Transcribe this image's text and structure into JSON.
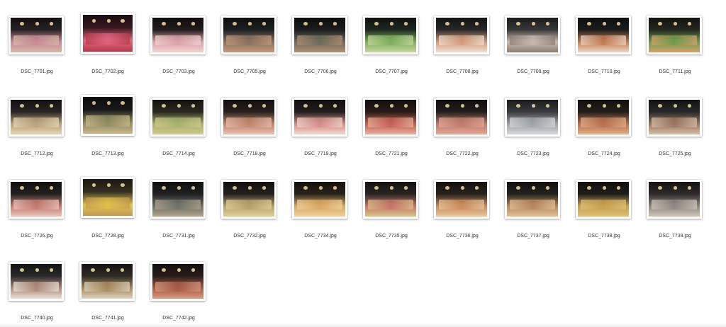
{
  "files": [
    {
      "name": "DSC_7701.jpg",
      "tones": [
        "#2a2326",
        "#c98a94",
        "#d4b9a8"
      ]
    },
    {
      "name": "DSC_7702.jpg",
      "tones": [
        "#3a1a22",
        "#e2657f",
        "#b33a4a"
      ]
    },
    {
      "name": "DSC_7703.jpg",
      "tones": [
        "#241d1d",
        "#dca0a8",
        "#f0d4d0"
      ]
    },
    {
      "name": "DSC_7705.jpg",
      "tones": [
        "#1e2124",
        "#8a6f60",
        "#c59a7a"
      ]
    },
    {
      "name": "DSC_7706.jpg",
      "tones": [
        "#1c1d1e",
        "#6d6a5a",
        "#b38e76"
      ]
    },
    {
      "name": "DSC_7707.jpg",
      "tones": [
        "#1f2a22",
        "#7cae5c",
        "#c9d7a0"
      ]
    },
    {
      "name": "DSC_7708.jpg",
      "tones": [
        "#2b2a2a",
        "#d39a7a",
        "#efe0d4"
      ]
    },
    {
      "name": "DSC_7709.jpg",
      "tones": [
        "#3c3b3b",
        "#c8bcb0",
        "#8a7e72"
      ]
    },
    {
      "name": "DSC_7710.jpg",
      "tones": [
        "#1e1e1e",
        "#c27a52",
        "#ead8c8"
      ]
    },
    {
      "name": "DSC_7711.jpg",
      "tones": [
        "#262a21",
        "#6f9c4e",
        "#d6a06c"
      ]
    },
    {
      "name": "DSC_7712.jpg",
      "tones": [
        "#2a2725",
        "#b8a27a",
        "#e6d6b4"
      ]
    },
    {
      "name": "DSC_7713.jpg",
      "tones": [
        "#1a1a1a",
        "#8f8a60",
        "#c9b98c"
      ]
    },
    {
      "name": "DSC_7714.jpg",
      "tones": [
        "#2b2a22",
        "#a5b36a",
        "#d5c690"
      ]
    },
    {
      "name": "DSC_7718.jpg",
      "tones": [
        "#2a2220",
        "#c0856c",
        "#e9bfb0"
      ]
    },
    {
      "name": "DSC_7719.jpg",
      "tones": [
        "#24201f",
        "#d58c88",
        "#f0d8cc"
      ]
    },
    {
      "name": "DSC_7721.jpg",
      "tones": [
        "#2b1d1b",
        "#c65f55",
        "#e8b29c"
      ]
    },
    {
      "name": "DSC_7722.jpg",
      "tones": [
        "#231f1e",
        "#c07b6c",
        "#e3a898"
      ]
    },
    {
      "name": "DSC_7723.jpg",
      "tones": [
        "#3b3d40",
        "#9ea3a8",
        "#d8d9da"
      ]
    },
    {
      "name": "DSC_7724.jpg",
      "tones": [
        "#27201d",
        "#b86f50",
        "#e2b08a"
      ]
    },
    {
      "name": "DSC_7725.jpg",
      "tones": [
        "#2a2a2b",
        "#9a7560",
        "#d8c0a8"
      ]
    },
    {
      "name": "DSC_7726.jpg",
      "tones": [
        "#262322",
        "#c47870",
        "#e8c8bc"
      ]
    },
    {
      "name": "DSC_7728.jpg",
      "tones": [
        "#3a3324",
        "#e0c24a",
        "#c29a56"
      ]
    },
    {
      "name": "DSC_7731.jpg",
      "tones": [
        "#1f2123",
        "#6d7168",
        "#b3a48c"
      ]
    },
    {
      "name": "DSC_7732.jpg",
      "tones": [
        "#262220",
        "#b5a06a",
        "#e1cf9a"
      ]
    },
    {
      "name": "DSC_7734.jpg",
      "tones": [
        "#2d241c",
        "#d9a864",
        "#f0d29c"
      ]
    },
    {
      "name": "DSC_7735.jpg",
      "tones": [
        "#2b2725",
        "#c6746a",
        "#d9c48a"
      ]
    },
    {
      "name": "DSC_7736.jpg",
      "tones": [
        "#29231f",
        "#c98b5c",
        "#e7c89e"
      ]
    },
    {
      "name": "DSC_7737.jpg",
      "tones": [
        "#262320",
        "#b8865e",
        "#e0c39a"
      ]
    },
    {
      "name": "DSC_7738.jpg",
      "tones": [
        "#22201d",
        "#c8a04e",
        "#dcc27a"
      ]
    },
    {
      "name": "DSC_7739.jpg",
      "tones": [
        "#2f2d2b",
        "#8f8680",
        "#cfc6bc"
      ]
    },
    {
      "name": "DSC_7740.jpg",
      "tones": [
        "#2b2b2c",
        "#b08a7a",
        "#e8e2d8"
      ]
    },
    {
      "name": "DSC_7741.jpg",
      "tones": [
        "#302c27",
        "#a88a5c",
        "#dcd2c0"
      ]
    },
    {
      "name": "DSC_7742.jpg",
      "tones": [
        "#2a1f1c",
        "#a85a44",
        "#d69a80"
      ]
    }
  ]
}
